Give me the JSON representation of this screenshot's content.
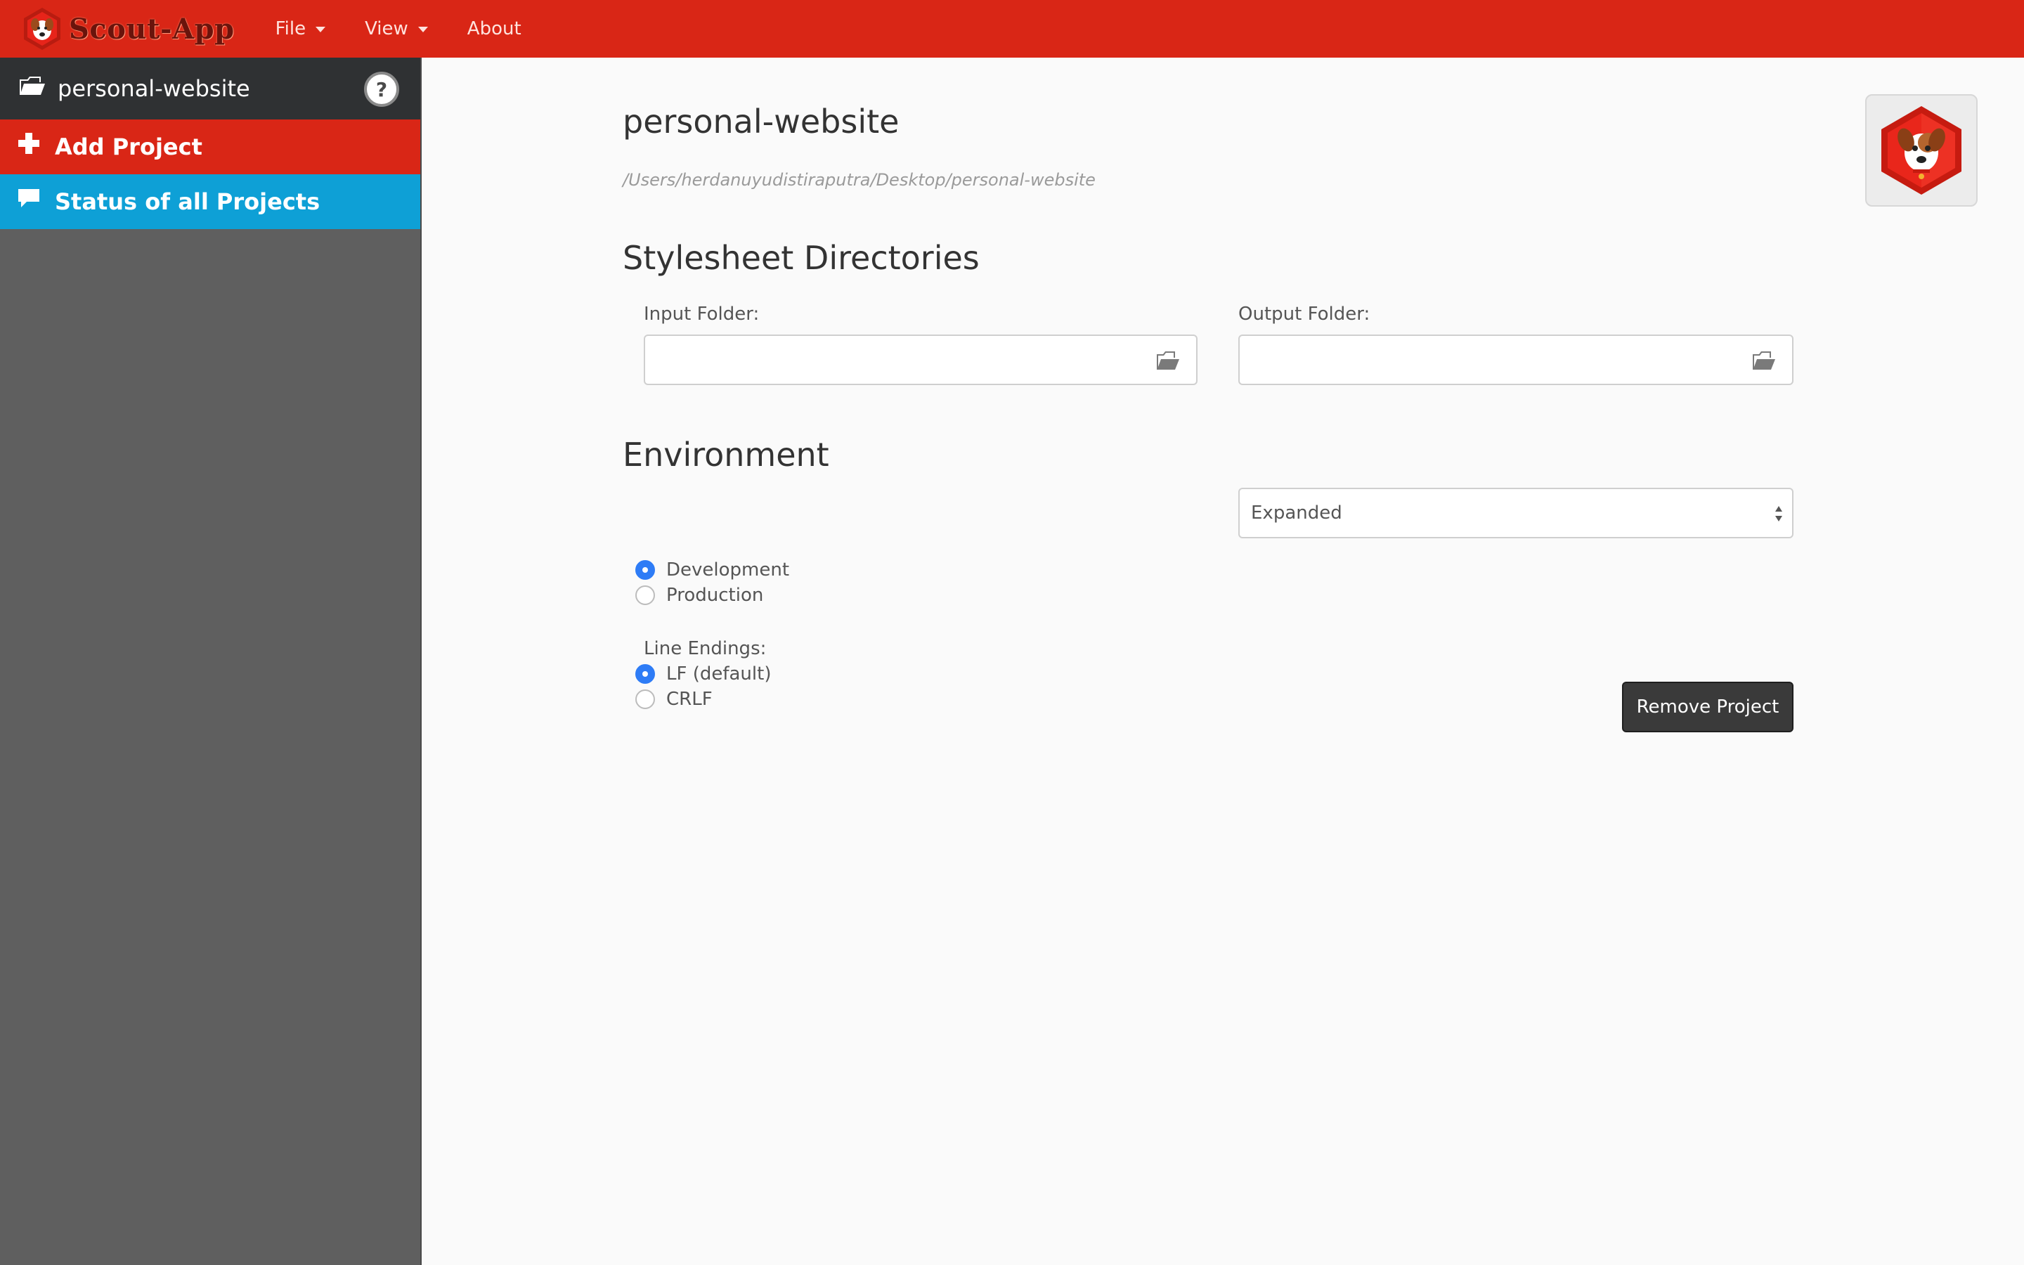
{
  "app": {
    "brand": "Scout-App",
    "menu": [
      {
        "label": "File"
      },
      {
        "label": "View"
      },
      {
        "label": "About"
      }
    ]
  },
  "sidebar": {
    "project_name": "personal-website",
    "help_glyph": "?",
    "add_project_label": "Add Project",
    "status_label": "Status of all Projects"
  },
  "main": {
    "title": "personal-website",
    "path": "/Users/herdanuyudistiraputra/Desktop/personal-website",
    "stylesheet_heading": "Stylesheet Directories",
    "input_label": "Input Folder:",
    "input_value": "",
    "output_label": "Output Folder:",
    "output_value": "",
    "environment_heading": "Environment",
    "environment_options": [
      {
        "label": "Development",
        "checked": true
      },
      {
        "label": "Production",
        "checked": false
      }
    ],
    "output_style_selected": "Expanded",
    "line_endings_label": "Line Endings:",
    "line_endings_options": [
      {
        "label": "LF (default)",
        "checked": true
      },
      {
        "label": "CRLF",
        "checked": false
      }
    ],
    "remove_button_label": "Remove Project"
  },
  "colors": {
    "navbar_red": "#d92616",
    "sidebar_dark": "#2f3133",
    "sidebar_gray": "#5f5f5f",
    "status_blue": "#0ea0d6",
    "radio_blue": "#2e7cf6",
    "remove_button": "#3a3a3a"
  },
  "icons": {
    "brand": "scout-dog-hexagon-icon",
    "project": "folder-open-icon",
    "help": "question-circle-icon",
    "add": "plus-icon",
    "status": "comment-icon",
    "folder_picker": "folder-open-icon",
    "select": "updown-arrows-icon"
  }
}
